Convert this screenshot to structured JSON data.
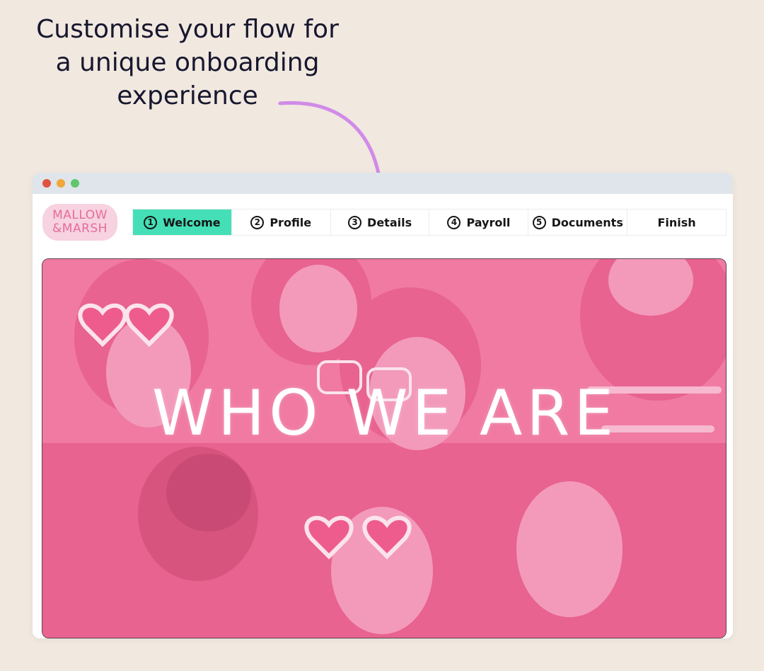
{
  "headline": {
    "line1": "Customise your flow for",
    "line2": "a unique onboarding",
    "line3": "experience"
  },
  "colors": {
    "background": "#f1e8e0",
    "arrow": "#d08be8",
    "active_tab": "#44dfb6",
    "hero_overlay": "#f07aa2",
    "logo": "#e56c9a"
  },
  "browser": {
    "window_controls": [
      "close-dot",
      "minimize-dot",
      "maximize-dot"
    ],
    "logo": {
      "line1": "MALLOW",
      "line2": "&MARSH"
    },
    "tabs": [
      {
        "number": "1",
        "label": "Welcome",
        "active": true
      },
      {
        "number": "2",
        "label": "Profile"
      },
      {
        "number": "3",
        "label": "Details"
      },
      {
        "number": "4",
        "label": "Payroll"
      },
      {
        "number": "5",
        "label": "Documents"
      },
      {
        "number": "",
        "label": "Finish"
      }
    ],
    "hero": {
      "title": "WHO WE ARE"
    }
  }
}
